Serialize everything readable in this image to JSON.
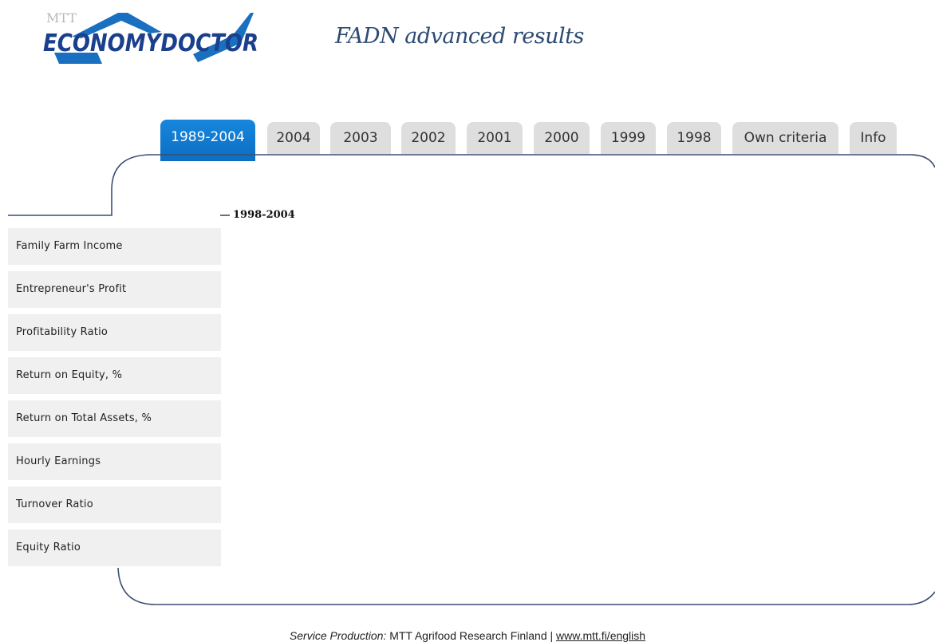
{
  "logo": {
    "small_text": "MTT",
    "brand": "ECONOMYDOCTOR"
  },
  "header": {
    "title": "FADN advanced results"
  },
  "tabs": [
    {
      "label": "1989-2004",
      "active": true
    },
    {
      "label": "2004",
      "active": false
    },
    {
      "label": "2003",
      "active": false
    },
    {
      "label": "2002",
      "active": false
    },
    {
      "label": "2001",
      "active": false
    },
    {
      "label": "2000",
      "active": false
    },
    {
      "label": "1999",
      "active": false
    },
    {
      "label": "1998",
      "active": false
    },
    {
      "label": "Own criteria",
      "active": false
    },
    {
      "label": "Info",
      "active": false
    }
  ],
  "content": {
    "period": "1998-2004"
  },
  "sidebar": {
    "items": [
      {
        "label": "Family Farm Income"
      },
      {
        "label": "Entrepreneur's Profit"
      },
      {
        "label": "Profitability Ratio"
      },
      {
        "label": "Return on Equity, %"
      },
      {
        "label": "Return on Total Assets, %"
      },
      {
        "label": "Hourly Earnings"
      },
      {
        "label": "Turnover Ratio"
      },
      {
        "label": "Equity Ratio"
      }
    ]
  },
  "footer": {
    "prefix": "Service Production:",
    "org": "MTT Agrifood Research Finland |",
    "link": "www.mtt.fi/english"
  },
  "colors": {
    "accent": "#0c74cc",
    "frame": "#3b4d74",
    "title": "#2d4a73"
  }
}
